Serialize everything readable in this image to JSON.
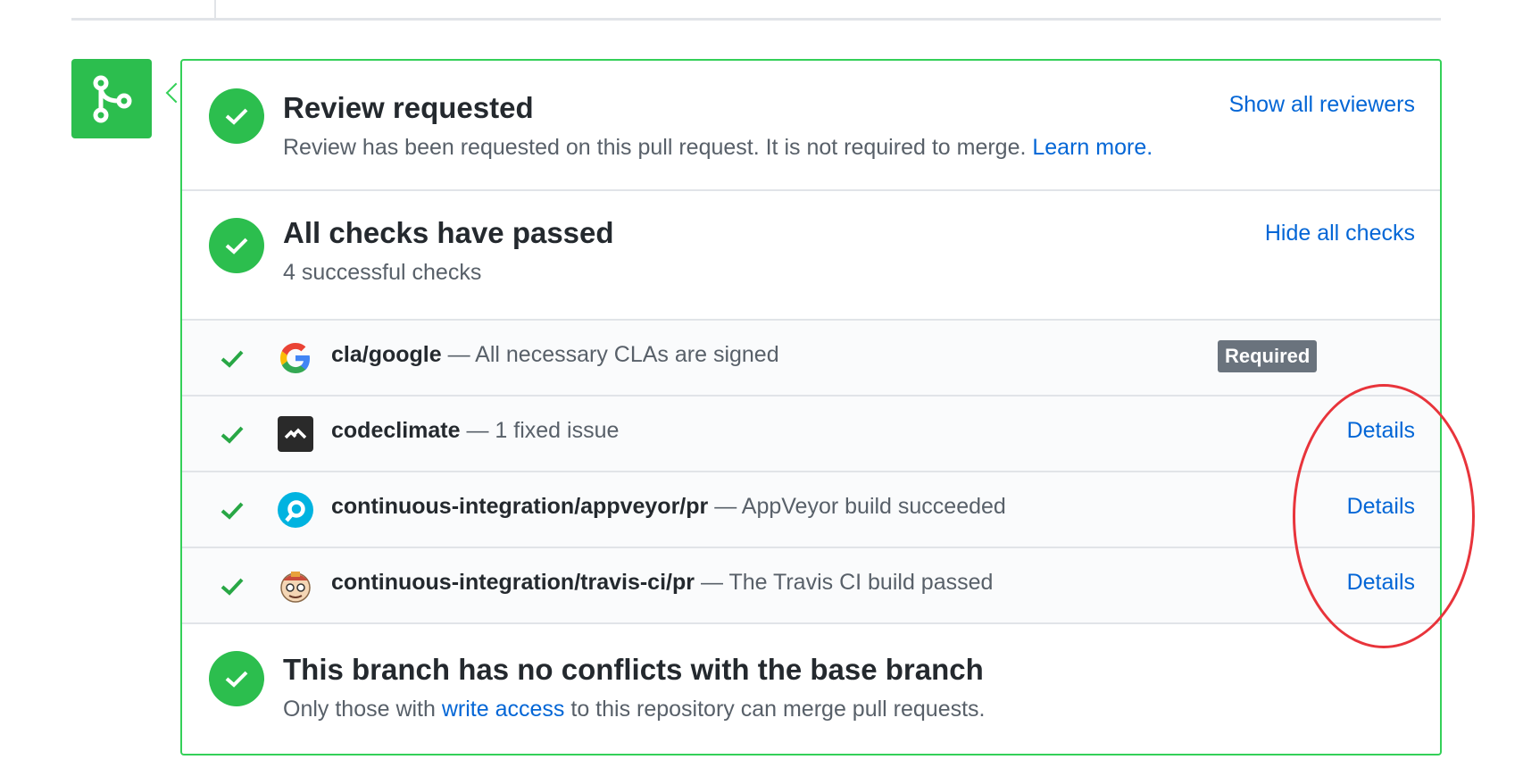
{
  "review": {
    "title": "Review requested",
    "description": "Review has been requested on this pull request. It is not required to merge.",
    "learn_more": "Learn more.",
    "show_reviewers": "Show all reviewers"
  },
  "checks": {
    "title": "All checks have passed",
    "summary": "4 successful checks",
    "hide_checks": "Hide all checks",
    "separator": "—",
    "items": [
      {
        "context": "cla/google",
        "description": "All necessary CLAs are signed",
        "badge": "Required",
        "icon": "google-icon"
      },
      {
        "context": "codeclimate",
        "description": "1 fixed issue",
        "details": "Details",
        "icon": "codeclimate-icon"
      },
      {
        "context": "continuous-integration/appveyor/pr",
        "description": "AppVeyor build succeeded",
        "details": "Details",
        "icon": "appveyor-icon"
      },
      {
        "context": "continuous-integration/travis-ci/pr",
        "description": "The Travis CI build passed",
        "details": "Details",
        "icon": "travis-ci-icon"
      }
    ]
  },
  "merge": {
    "title": "This branch has no conflicts with the base branch",
    "description_before": "Only those with",
    "write_access": "write access",
    "description_after": "to this repository can merge pull requests."
  },
  "colors": {
    "success": "#2cbe4e",
    "link": "#0366d6",
    "annotation": "#e8343b",
    "badge": "#6a737d"
  }
}
